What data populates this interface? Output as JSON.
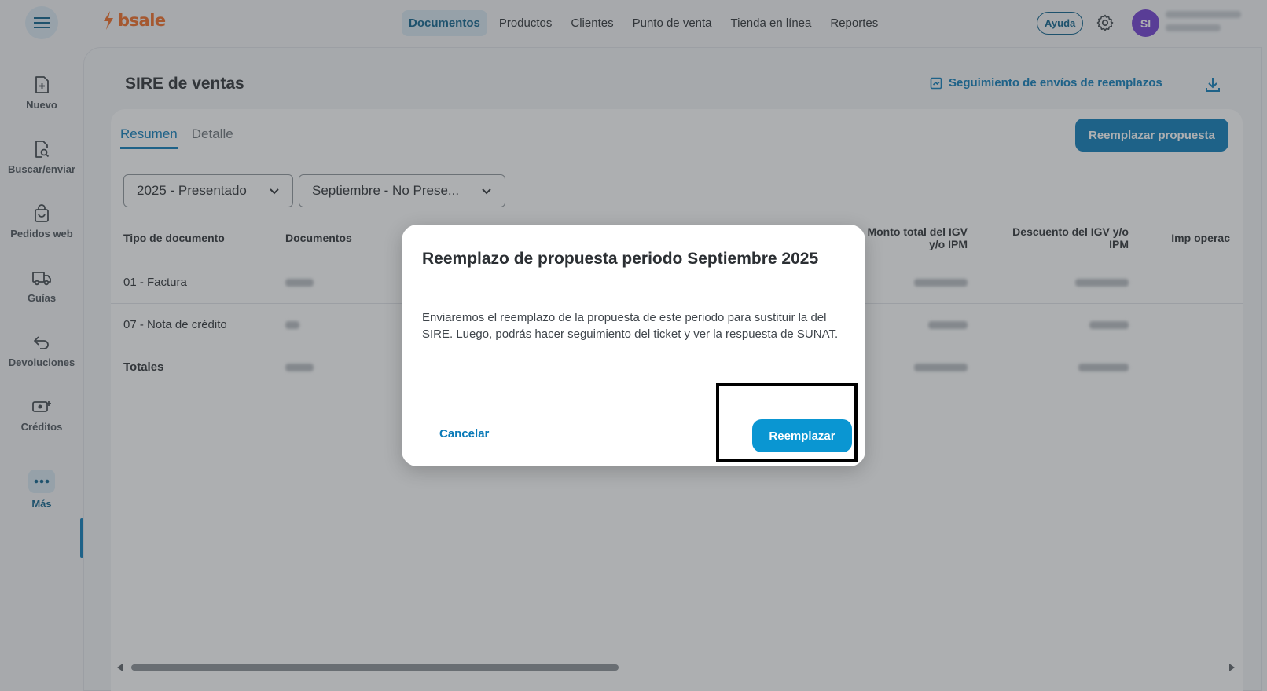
{
  "header": {
    "logo_text": "bsale",
    "nav": [
      {
        "label": "Documentos",
        "active": true
      },
      {
        "label": "Productos",
        "active": false
      },
      {
        "label": "Clientes",
        "active": false
      },
      {
        "label": "Punto de venta",
        "active": false
      },
      {
        "label": "Tienda en línea",
        "active": false
      },
      {
        "label": "Reportes",
        "active": false
      }
    ],
    "help_label": "Ayuda",
    "avatar_initials": "SI"
  },
  "sidebar": {
    "items": [
      {
        "label": "Nuevo",
        "icon": "new-document-icon"
      },
      {
        "label": "Buscar/enviar",
        "icon": "search-document-icon"
      },
      {
        "label": "Pedidos web",
        "icon": "shopping-bag-icon"
      },
      {
        "label": "Guías",
        "icon": "truck-icon"
      },
      {
        "label": "Devoluciones",
        "icon": "return-arrow-icon"
      },
      {
        "label": "Créditos",
        "icon": "cash-icon"
      },
      {
        "label": "Más",
        "icon": "more-dots-icon",
        "active": true
      }
    ]
  },
  "page": {
    "title": "SIRE de ventas",
    "tracking_link": "Seguimiento de envíos de reemplazos",
    "tabs": [
      {
        "label": "Resumen",
        "active": true
      },
      {
        "label": "Detalle",
        "active": false
      }
    ],
    "replace_button": "Reemplazar propuesta",
    "year_select": "2025 - Presentado",
    "month_select": "Septiembre - No Prese..."
  },
  "table": {
    "headers": [
      "Tipo de documento",
      "Documentos",
      "",
      "",
      "",
      "Monto total del IGV y/o IPM",
      "Descuento del IGV y/o IPM",
      "Imp operac"
    ],
    "rows": [
      {
        "tipo": "01 - Factura"
      },
      {
        "tipo": "07 - Nota de crédito"
      },
      {
        "tipo": "Totales",
        "total": true
      }
    ]
  },
  "modal": {
    "title": "Reemplazo de propuesta periodo Septiembre 2025",
    "body": "Enviaremos el reemplazo de la propuesta de este periodo para sustituir la del SIRE. Luego, podrás hacer seguimiento del ticket y ver la respuesta de SUNAT.",
    "cancel_label": "Cancelar",
    "confirm_label": "Reemplazar"
  },
  "colors": {
    "brand": "#f26a21",
    "primary": "#0a7ab8",
    "confirm": "#0a96d2",
    "avatar": "#6f3bd0"
  }
}
